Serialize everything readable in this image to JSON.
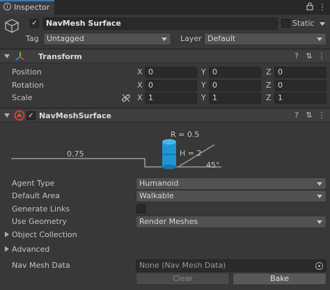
{
  "window": {
    "tab_label": "Inspector",
    "lock_icon": "lock-icon",
    "menu_icon": "kebab-menu-icon"
  },
  "object": {
    "name": "NavMesh Surface",
    "static_label": "Static",
    "tag_label": "Tag",
    "tag_value": "Untagged",
    "layer_label": "Layer",
    "layer_value": "Default"
  },
  "transform": {
    "title": "Transform",
    "position_label": "Position",
    "rotation_label": "Rotation",
    "scale_label": "Scale",
    "x_label": "X",
    "y_label": "Y",
    "z_label": "Z",
    "position": [
      "0",
      "0",
      "0"
    ],
    "rotation": [
      "0",
      "0",
      "0"
    ],
    "scale": [
      "1",
      "1",
      "1"
    ]
  },
  "navmesh": {
    "title": "NavMeshSurface",
    "diagram": {
      "radius": "R = 0.5",
      "height": "H = 2",
      "step": "0.75",
      "slope": "45°"
    },
    "agent_type_label": "Agent Type",
    "agent_type_value": "Humanoid",
    "default_area_label": "Default Area",
    "default_area_value": "Walkable",
    "generate_links_label": "Generate Links",
    "use_geometry_label": "Use Geometry",
    "use_geometry_value": "Render Meshes",
    "object_collection_label": "Object Collection",
    "advanced_label": "Advanced",
    "nav_mesh_data_label": "Nav Mesh Data",
    "nav_mesh_data_value": "None (Nav Mesh Data)",
    "clear_label": "Clear",
    "bake_label": "Bake"
  },
  "colors": {
    "accent": "#3a79bb",
    "capsule": "#1e96d4"
  }
}
